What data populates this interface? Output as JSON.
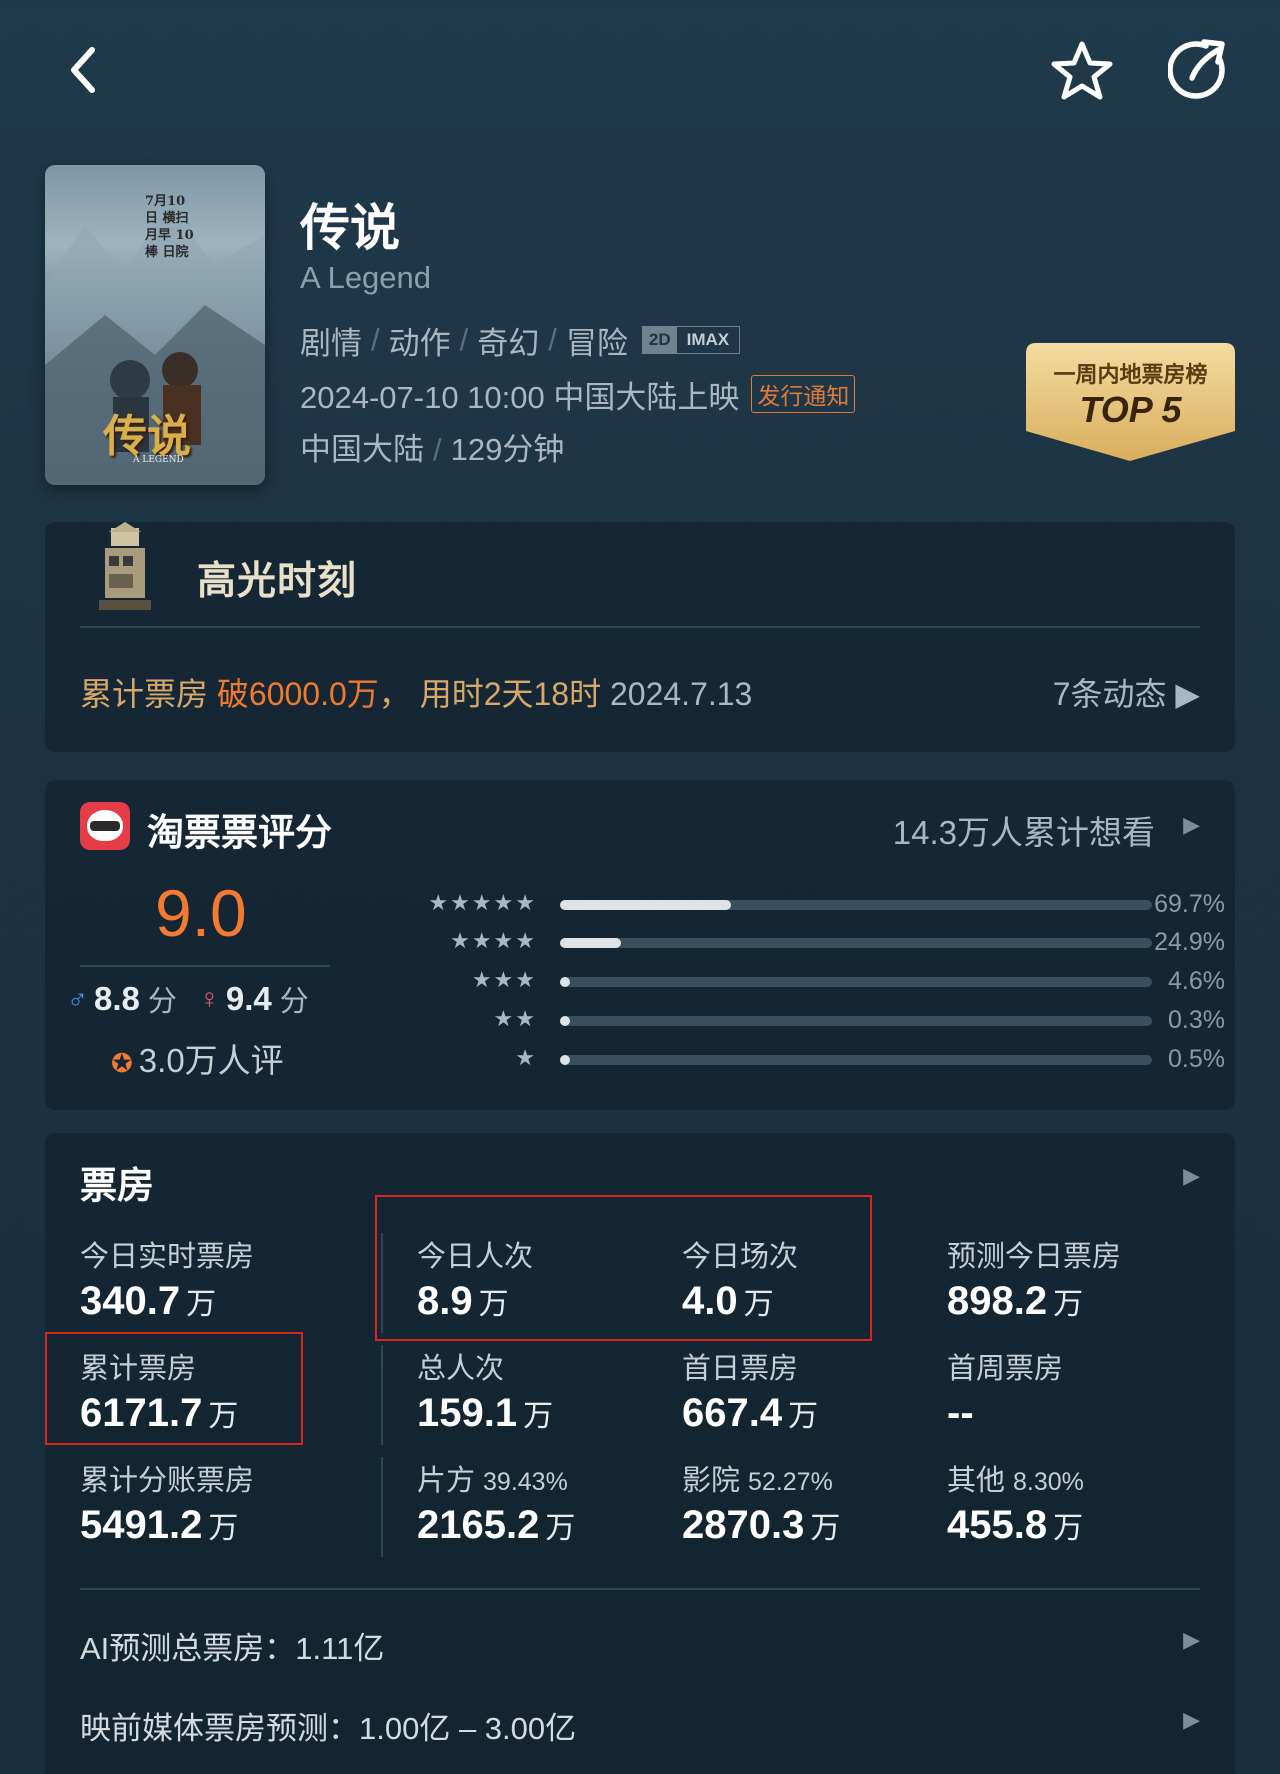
{
  "film": {
    "title": "传说",
    "english_title": "A Legend",
    "genres": [
      "剧情",
      "动作",
      "奇幻",
      "冒险"
    ],
    "formats": [
      "2D",
      "IMAX"
    ],
    "release": "2024-07-10 10:00 中国大陆上映",
    "release_notice": "发行通知",
    "country": "中国大陆",
    "duration": "129分钟",
    "poster": {
      "title": "传说",
      "subtitle": "A LEGEND",
      "side_text": "7月10日 横扫 月早 10 棒 日院"
    }
  },
  "badge": {
    "label": "一周内地票房榜",
    "rank": "TOP 5"
  },
  "highlight": {
    "title": "高光时刻",
    "text_prefix": "累计票房 ",
    "text_emph": "破6000.0万",
    "text_mid": "， 用时2天18时 ",
    "text_date": "2024.7.13",
    "more": "7条动态 ▶"
  },
  "rating": {
    "title": "淘票票评分",
    "want_see": "14.3万人累计想看",
    "score": "9.0",
    "male_score": "8.8",
    "female_score": "9.4",
    "score_unit": "分",
    "raters": "3.0万人评",
    "distribution": [
      {
        "stars": "★★★★★",
        "percent": 69.7,
        "label": "69.7%"
      },
      {
        "stars": "★★★★",
        "percent": 24.9,
        "label": "24.9%"
      },
      {
        "stars": "★★★",
        "percent": 4.6,
        "label": "4.6%"
      },
      {
        "stars": "★★",
        "percent": 0.3,
        "label": "0.3%"
      },
      {
        "stars": "★",
        "percent": 0.5,
        "label": "0.5%"
      }
    ]
  },
  "boxoffice": {
    "title": "票房",
    "unit": "万",
    "stats": [
      {
        "label": "今日实时票房",
        "value": "340.7",
        "pct": ""
      },
      {
        "label": "今日人次",
        "value": "8.9",
        "pct": ""
      },
      {
        "label": "今日场次",
        "value": "4.0",
        "pct": ""
      },
      {
        "label": "预测今日票房",
        "value": "898.2",
        "pct": ""
      },
      {
        "label": "累计票房",
        "value": "6171.7",
        "pct": ""
      },
      {
        "label": "总人次",
        "value": "159.1",
        "pct": ""
      },
      {
        "label": "首日票房",
        "value": "667.4",
        "pct": ""
      },
      {
        "label": "首周票房",
        "value": "--",
        "pct": ""
      },
      {
        "label": "累计分账票房",
        "value": "5491.2",
        "pct": ""
      },
      {
        "label": "片方",
        "value": "2165.2",
        "pct": "39.43%"
      },
      {
        "label": "影院",
        "value": "2870.3",
        "pct": "52.27%"
      },
      {
        "label": "其他",
        "value": "455.8",
        "pct": "8.30%"
      }
    ],
    "ai_forecast": "AI预测总票房：1.11亿",
    "media_forecast": "映前媒体票房预测：1.00亿 – 3.00亿"
  },
  "colors": {
    "accent": "#f37b2f",
    "highlight_text": "#d7a86a",
    "annotation_box": "#d8261c",
    "gold_badge": "#e9c77a"
  },
  "icons": [
    "back-arrow-icon",
    "star-outline-icon",
    "share-icon",
    "film-reel-icon",
    "taopiaopiao-logo-icon",
    "male-icon",
    "female-icon",
    "star-rating-icon",
    "chevron-right-icon"
  ]
}
